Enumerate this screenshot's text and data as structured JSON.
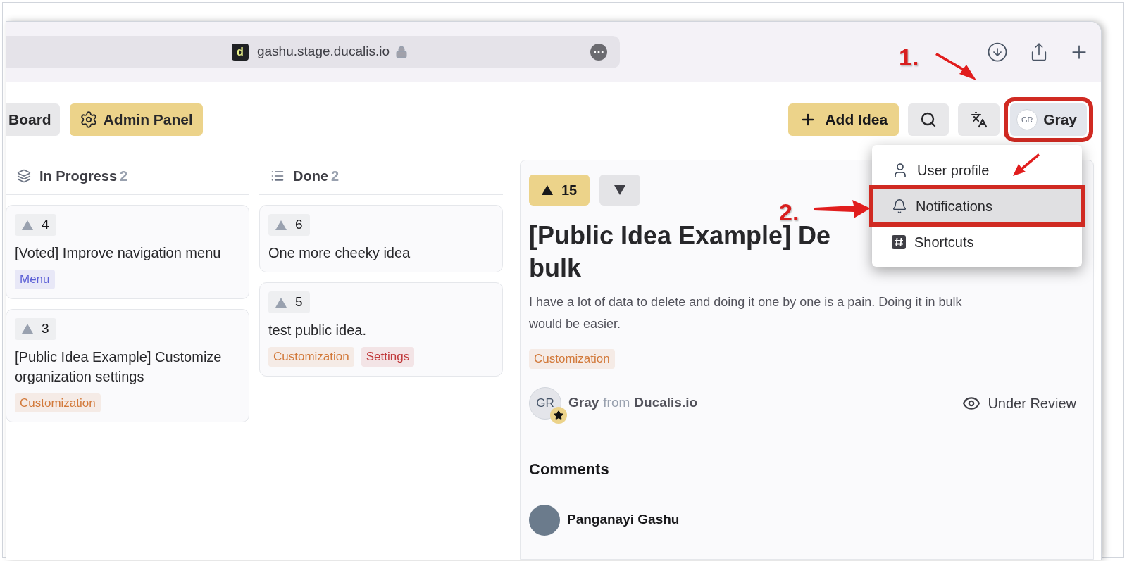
{
  "browser": {
    "site_icon_letter": "d",
    "url": "gashu.stage.ducalis.io"
  },
  "nav": {
    "left_buttons": [
      {
        "label": "Board",
        "kind": "plain"
      },
      {
        "label": "Admin Panel",
        "kind": "primary"
      }
    ],
    "add_idea": "Add Idea",
    "user": {
      "initials": "GR",
      "name": "Gray"
    }
  },
  "columns": [
    {
      "title": "In Progress",
      "count": "2",
      "kind": "layers",
      "cards": [
        {
          "votes": "4",
          "title": "[Voted] Improve navigation menu",
          "tags": [
            {
              "label": "Menu",
              "color": "#5b5fd6"
            }
          ]
        },
        {
          "votes": "3",
          "title": "[Public Idea Example] Customize organization settings",
          "tags": [
            {
              "label": "Customization",
              "color": "#d2793a"
            }
          ]
        }
      ]
    },
    {
      "title": "Done",
      "count": "2",
      "kind": "list",
      "cards": [
        {
          "votes": "6",
          "title": "One more cheeky idea"
        },
        {
          "votes": "5",
          "title": "test public idea.",
          "tags": [
            {
              "label": "Customization",
              "color": "#d2793a"
            },
            {
              "label": "Settings",
              "color": "#c0393b"
            }
          ]
        }
      ]
    }
  ],
  "idea": {
    "upvotes": "15",
    "title_lines": [
      "[Public Idea Example] De",
      "bulk"
    ],
    "description": "I have a lot of data to delete and doing it one by one is a pain. Doing it in bulk would be easier.",
    "tags": [
      {
        "label": "Customization",
        "color": "#d2793a"
      }
    ],
    "author": {
      "initials": "GR",
      "name": "Gray",
      "from": "from",
      "org": "Ducalis.io"
    },
    "status": "Under Review",
    "comments_heading": "Comments",
    "comments": [
      {
        "author": "Panganayi Gashu"
      }
    ]
  },
  "user_menu": [
    {
      "label": "User profile",
      "kind": "user",
      "selected": false
    },
    {
      "label": "Notifications",
      "kind": "bell",
      "selected": true
    },
    {
      "label": "Shortcuts",
      "kind": "hash",
      "selected": false
    }
  ],
  "annotations": [
    {
      "label": "1."
    },
    {
      "label": "2."
    }
  ]
}
